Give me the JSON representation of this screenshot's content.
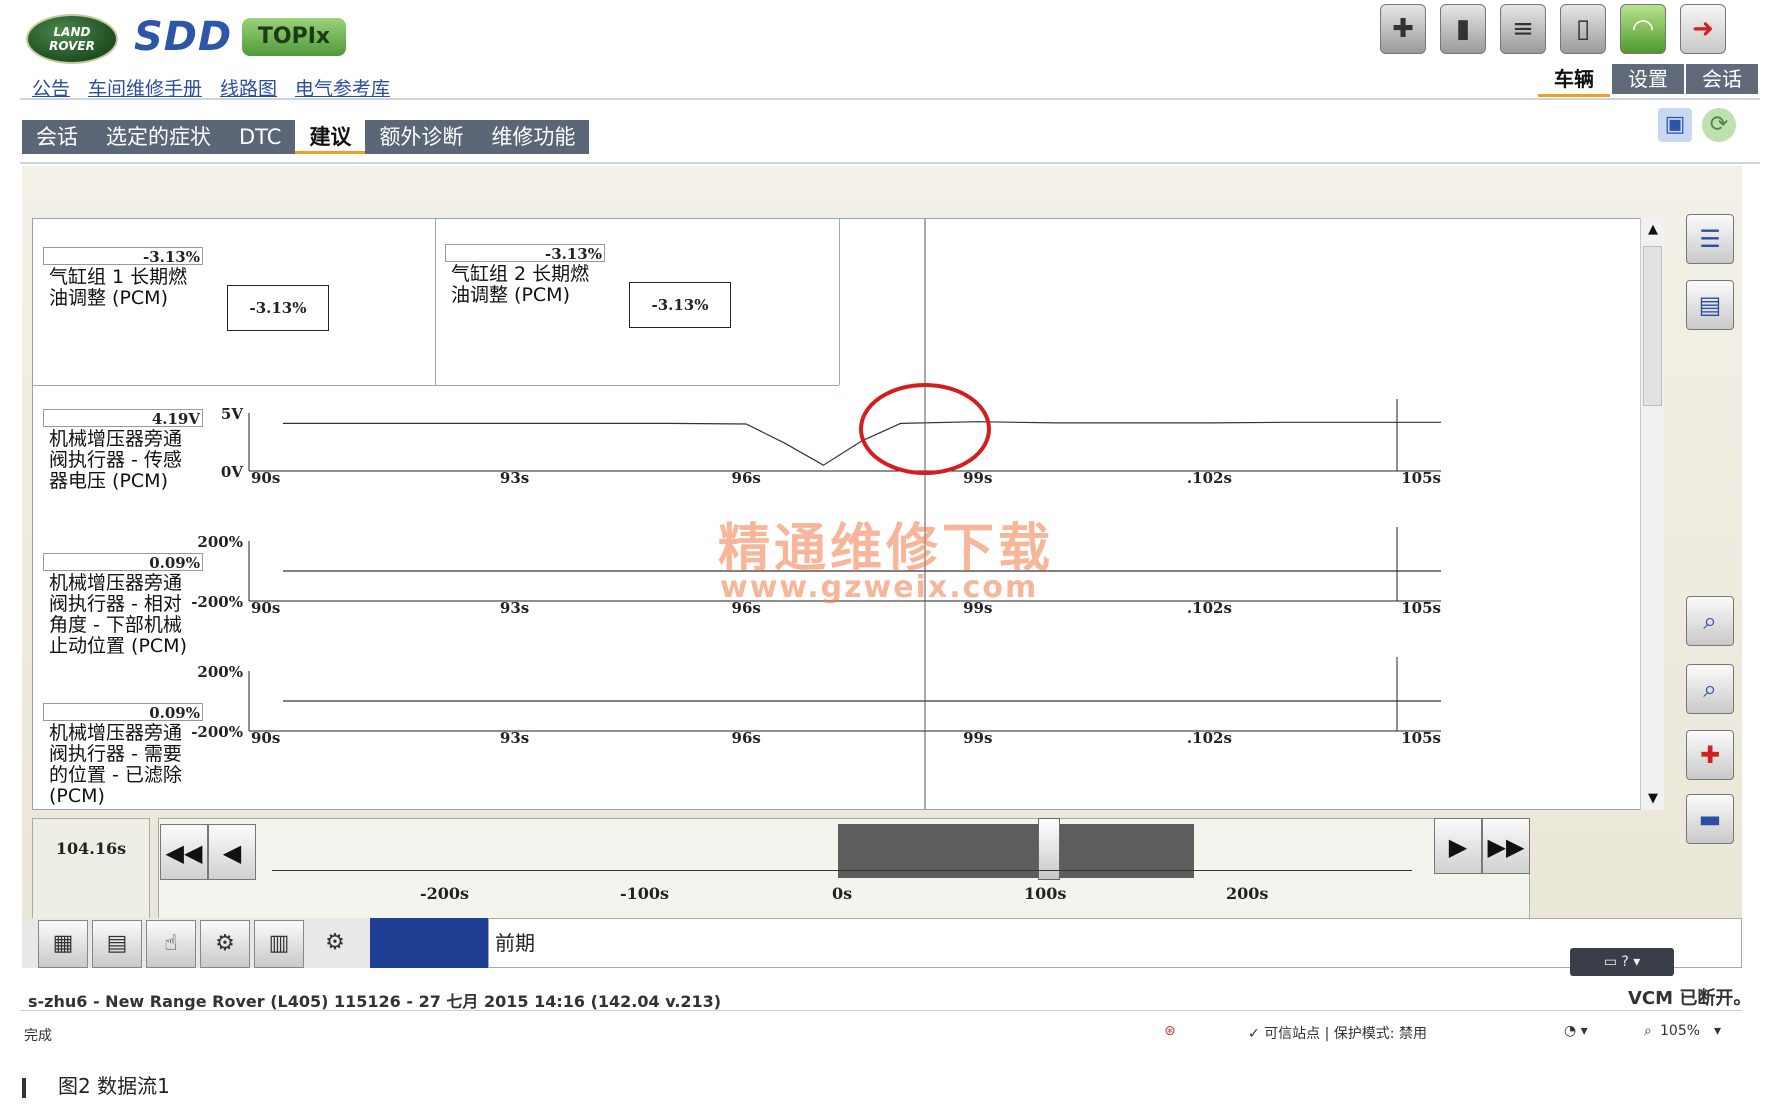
{
  "header": {
    "brand_land": "LAND",
    "brand_rover": "ROVER",
    "brand_sdd": "SDD",
    "brand_topix": "TOPIx",
    "links": [
      "公告",
      "车间维修手册",
      "线路图",
      "电气参考库"
    ],
    "right_tabs": [
      "车辆",
      "设置",
      "会话"
    ],
    "active_right_tab": "车辆"
  },
  "nav": {
    "tabs": [
      "会话",
      "选定的症状",
      "DTC",
      "建议",
      "额外诊断",
      "维修功能"
    ],
    "active": "建议"
  },
  "meters": [
    {
      "header": "-3.13%",
      "label": "气缸组 1 长期燃\n油调整 (PCM)",
      "value": "-3.13%"
    },
    {
      "header": "-3.13%",
      "label": "气缸组 2 长期燃\n油调整 (PCM)",
      "value": "-3.13%"
    }
  ],
  "chart_data": [
    {
      "type": "line",
      "header": "4.19V",
      "label": "机械增压器旁通\n阀执行器 - 传感\n器电压 (PCM)",
      "y_ticks": [
        "5V",
        "0V"
      ],
      "ylim": [
        0,
        5
      ],
      "x_ticks": [
        "90s",
        "93s",
        "96s",
        "99s",
        ".102s",
        "105s"
      ],
      "xlim": [
        90,
        105
      ],
      "x": [
        90,
        93,
        95,
        96,
        96.5,
        97,
        97.5,
        98,
        99,
        100,
        102,
        103,
        105
      ],
      "values": [
        4.1,
        4.1,
        4.1,
        4.05,
        2.4,
        0.5,
        2.6,
        4.1,
        4.25,
        4.15,
        4.15,
        4.2,
        4.2
      ]
    },
    {
      "type": "line",
      "header": "0.09%",
      "label": "机械增压器旁通\n阀执行器 - 相对\n角度 - 下部机械\n止动位置 (PCM)",
      "y_ticks": [
        "200%",
        "-200%"
      ],
      "ylim": [
        -200,
        200
      ],
      "x_ticks": [
        "90s",
        "93s",
        "96s",
        "99s",
        ".102s",
        "105s"
      ],
      "xlim": [
        90,
        105
      ],
      "x": [
        90,
        105
      ],
      "values": [
        0.09,
        0.09
      ]
    },
    {
      "type": "line",
      "header": "0.09%",
      "label": "机械增压器旁通\n阀执行器 - 需要\n的位置 - 已滤除\n(PCM)",
      "y_ticks": [
        "200%",
        "-200%"
      ],
      "ylim": [
        -200,
        200
      ],
      "x_ticks": [
        "90s",
        "93s",
        "96s",
        "99s",
        ".102s",
        "105s"
      ],
      "xlim": [
        90,
        105
      ],
      "x": [
        90,
        105
      ],
      "values": [
        0.09,
        0.09
      ]
    }
  ],
  "timeline": {
    "current_time": "104.16s",
    "ticks": [
      "-200s",
      "-100s",
      "0s",
      "100s",
      "200s"
    ]
  },
  "status": {
    "field_text": "前期",
    "session_line": "s-zhu6 - New Range Rover (L405) 115126 - 27 七月 2015 14:16 (142.04 v.213)",
    "vcm": "VCM 已断开。",
    "done": "完成",
    "trusted": "✓ 可信站点 | 保护模式: 禁用",
    "zoom": "105%"
  },
  "caption": "图2   数据流1",
  "watermark": {
    "text": "精通维修下载",
    "url": "www.gzweix.com"
  },
  "colors": {
    "nav_bg": "#5b6777",
    "accent": "#f0a020",
    "link": "#2b4ea0",
    "highlight_ring": "#d41e1e"
  }
}
